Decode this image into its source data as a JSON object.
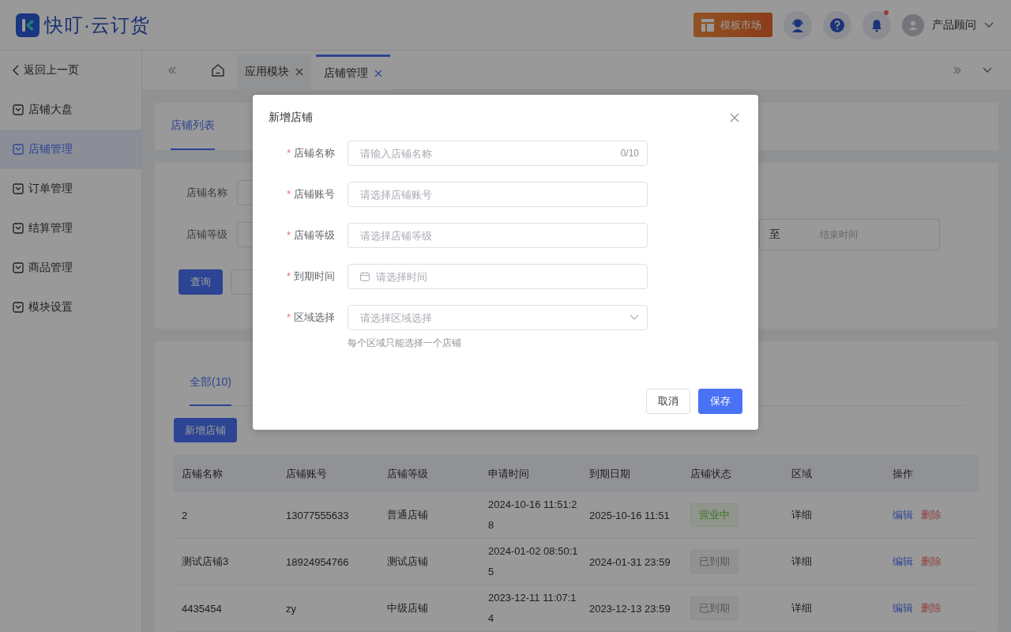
{
  "header": {
    "logo_text": "快叮·云订货",
    "template_button": "模板市场",
    "unread": true,
    "user": "产品顾问"
  },
  "sidebar": {
    "back": "返回上一页",
    "items": [
      {
        "label": "店铺大盘",
        "selected": false
      },
      {
        "label": "店铺管理",
        "selected": true
      },
      {
        "label": "订单管理",
        "selected": false
      },
      {
        "label": "结算管理",
        "selected": false
      },
      {
        "label": "商品管理",
        "selected": false
      },
      {
        "label": "模块设置",
        "selected": false
      }
    ]
  },
  "tab_bar": {
    "tabs": [
      {
        "label": "应用模块",
        "selected": false
      },
      {
        "label": "店铺管理",
        "selected": true
      }
    ]
  },
  "page_tabs": [
    {
      "label": "店铺列表",
      "selected": true
    }
  ],
  "filters": {
    "name_label": "店铺名称",
    "level_label": "店铺等级",
    "date_range": {
      "separator": "至",
      "end_placeholder": "结束时间"
    },
    "search_button": "查询"
  },
  "list": {
    "tabs": [
      {
        "label": "全部(10)",
        "selected": true
      }
    ],
    "add_button": "新增店铺",
    "table": {
      "columns": [
        "店铺名称",
        "店铺账号",
        "店铺等级",
        "申请时间",
        "到期日期",
        "店铺状态",
        "区域",
        "操作"
      ],
      "rows": [
        {
          "name": "2",
          "account": "13077555633",
          "level": "普通店铺",
          "applied": "2024-10-16 11:51:28",
          "expires": "2025-10-16 11:51",
          "status": {
            "label": "营业中",
            "kind": "active"
          },
          "region": "详细",
          "actions": [
            "编辑",
            "删除"
          ]
        },
        {
          "name": "测试店铺3",
          "account": "18924954766",
          "level": "测试店铺",
          "applied": "2024-01-02 08:50:15",
          "expires": "2024-01-31 23:59",
          "status": {
            "label": "已到期",
            "kind": "expired"
          },
          "region": "详细",
          "actions": [
            "编辑",
            "删除"
          ]
        },
        {
          "name": "4435454",
          "account": "zy",
          "level": "中级店铺",
          "applied": "2023-12-11 11:07:14",
          "expires": "2023-12-13 23:59",
          "status": {
            "label": "已到期",
            "kind": "expired"
          },
          "region": "详细",
          "actions": [
            "编辑",
            "删除"
          ]
        }
      ]
    }
  },
  "dialog": {
    "title": "新增店铺",
    "fields": [
      {
        "label": "店铺名称",
        "mark": "*",
        "kind": "text",
        "placeholder": "请输入店铺名称",
        "counter": "0/10"
      },
      {
        "label": "店铺账号",
        "mark": "*",
        "kind": "text",
        "placeholder": "请选择店铺账号"
      },
      {
        "label": "店铺等级",
        "mark": "*",
        "kind": "text",
        "placeholder": "请选择店铺等级"
      },
      {
        "label": "到期时间",
        "mark": "*",
        "kind": "date",
        "placeholder": "请选择时间"
      },
      {
        "label": "区域选择",
        "mark": "*",
        "kind": "select",
        "placeholder": "请选择区域选择"
      }
    ],
    "hint": "每个区域只能选择一个店铺",
    "buttons": [
      {
        "label": "取消",
        "kind": "default"
      },
      {
        "label": "保存",
        "kind": "primary"
      }
    ]
  }
}
